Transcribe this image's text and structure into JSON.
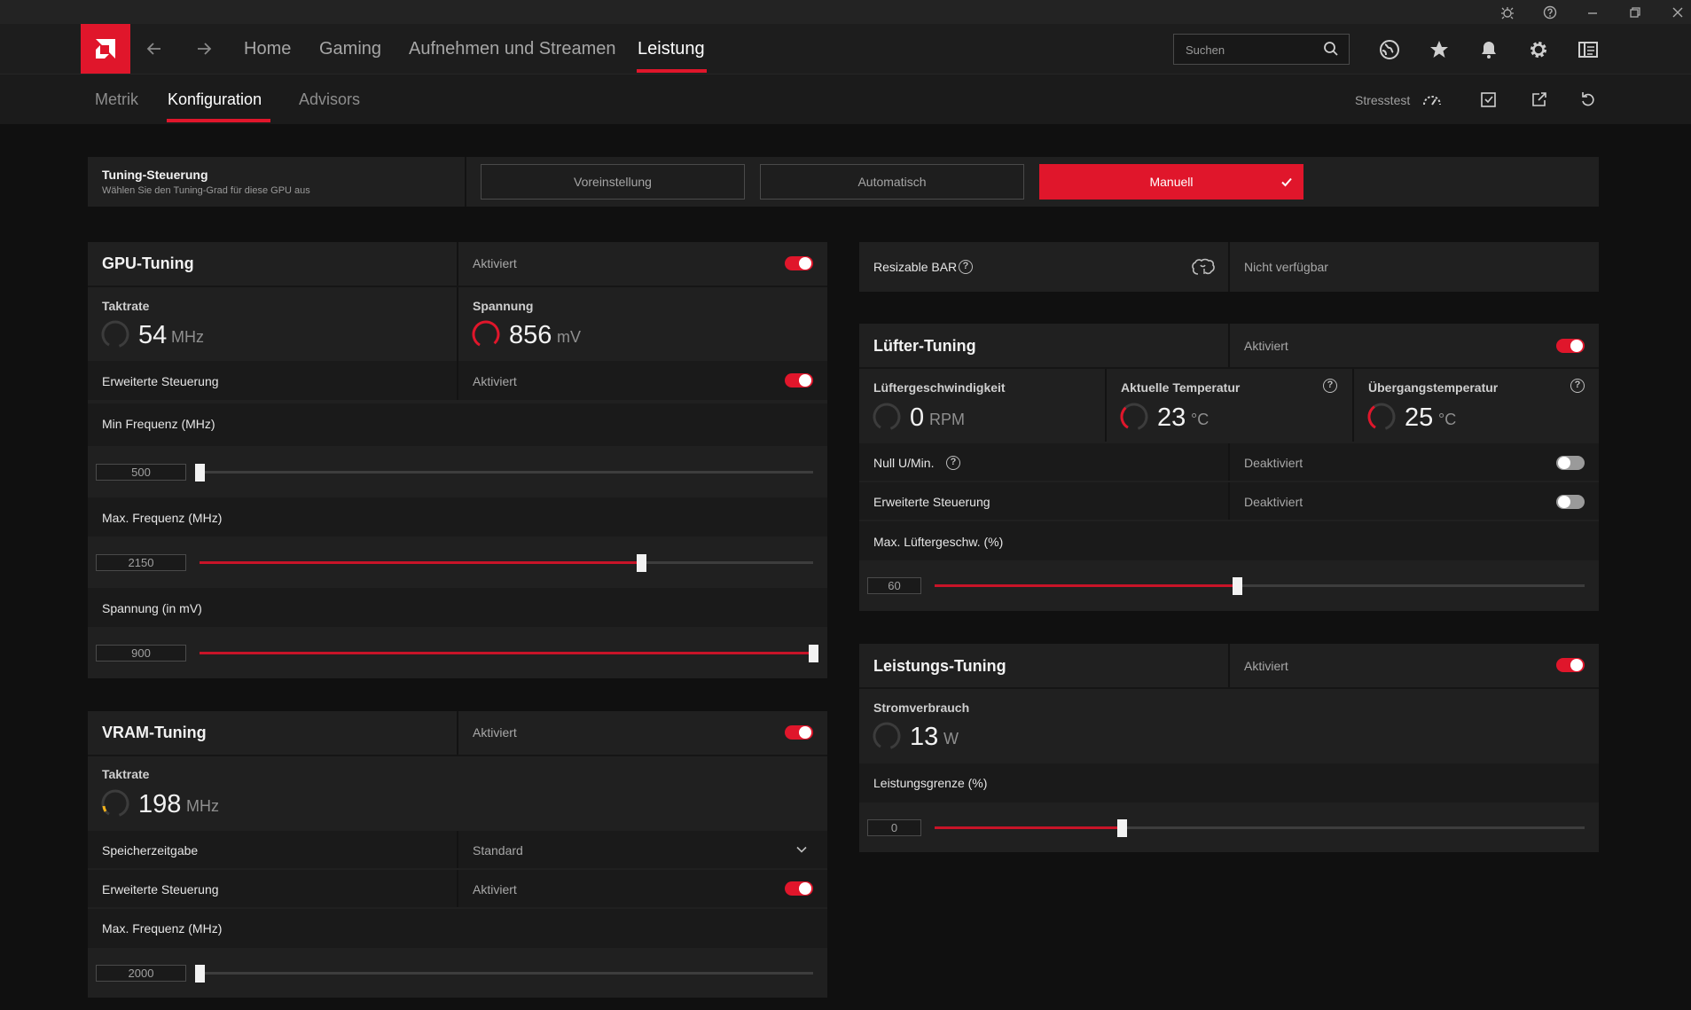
{
  "header": {
    "nav": [
      "Home",
      "Gaming",
      "Aufnehmen und Streamen",
      "Leistung"
    ],
    "search_placeholder": "Suchen",
    "icons": [
      "back-arrow-icon",
      "forward-arrow-icon",
      "globe-icon",
      "star-icon",
      "bell-icon",
      "gear-icon",
      "sidebar-layout-icon"
    ],
    "titlebar_icons": [
      "bug-icon",
      "help-icon",
      "minimize-icon",
      "restore-icon",
      "close-icon"
    ]
  },
  "subnav": {
    "tabs": [
      "Metrik",
      "Konfiguration",
      "Advisors"
    ],
    "stress_label": "Stresstest",
    "icons": [
      "stresstest-gauge-icon",
      "save-profile-icon",
      "export-icon",
      "reset-icon"
    ]
  },
  "tuning_control": {
    "title": "Tuning-Steuerung",
    "subtitle": "Wählen Sie den Tuning-Grad für diese GPU aus",
    "options": [
      "Voreinstellung",
      "Automatisch",
      "Manuell"
    ],
    "selected": "Manuell"
  },
  "gpu_tuning": {
    "title": "GPU-Tuning",
    "status": "Aktiviert",
    "clock": {
      "label": "Taktrate",
      "value": "54",
      "unit": "MHz"
    },
    "voltage": {
      "label": "Spannung",
      "value": "856",
      "unit": "mV"
    },
    "advanced_label": "Erweiterte Steuerung",
    "advanced_status": "Aktiviert",
    "min_freq": {
      "label": "Min Frequenz (MHz)",
      "value": "500",
      "fraction": 0.0
    },
    "max_freq": {
      "label": "Max. Frequenz (MHz)",
      "value": "2150",
      "fraction": 0.72
    },
    "voltage_slider": {
      "label": "Spannung (in mV)",
      "value": "900",
      "fraction": 1.0
    }
  },
  "vram_tuning": {
    "title": "VRAM-Tuning",
    "status": "Aktiviert",
    "clock": {
      "label": "Taktrate",
      "value": "198",
      "unit": "MHz"
    },
    "memory_timing_label": "Speicherzeitgabe",
    "memory_timing_value": "Standard",
    "advanced_label": "Erweiterte Steuerung",
    "advanced_status": "Aktiviert",
    "max_freq": {
      "label": "Max. Frequenz (MHz)",
      "value": "2000",
      "fraction": 0.0
    }
  },
  "resizable_bar": {
    "label": "Resizable BAR",
    "status": "Nicht verfügbar"
  },
  "fan_tuning": {
    "title": "Lüfter-Tuning",
    "status": "Aktiviert",
    "fan_speed": {
      "label": "Lüftergeschwindigkeit",
      "value": "0",
      "unit": "RPM"
    },
    "current_temp": {
      "label": "Aktuelle Temperatur",
      "value": "23",
      "unit": "°C"
    },
    "junction_temp": {
      "label": "Übergangstemperatur",
      "value": "25",
      "unit": "°C"
    },
    "zero_rpm_label": "Null U/Min.",
    "zero_rpm_status": "Deaktiviert",
    "advanced_label": "Erweiterte Steuerung",
    "advanced_status": "Deaktiviert",
    "max_fan": {
      "label": "Max. Lüftergeschw. (%)",
      "value": "60",
      "fraction": 0.465
    }
  },
  "power_tuning": {
    "title": "Leistungs-Tuning",
    "status": "Aktiviert",
    "power": {
      "label": "Stromverbrauch",
      "value": "13",
      "unit": "W"
    },
    "limit": {
      "label": "Leistungsgrenze (%)",
      "value": "0",
      "fraction": 0.288
    }
  },
  "colors": {
    "accent": "#e0162b",
    "background": "#101010",
    "panel": "#202020"
  }
}
